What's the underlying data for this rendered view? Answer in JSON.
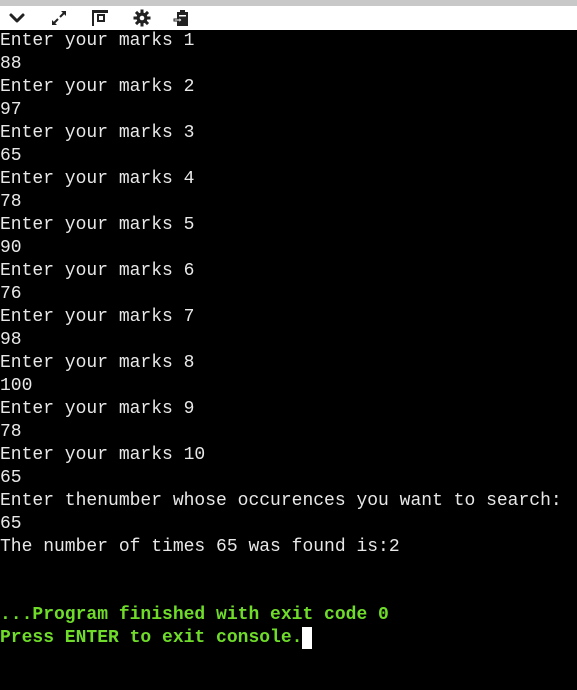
{
  "toolbar": {
    "icons": [
      "chevron-down-icon",
      "expand-icon",
      "layout-icon",
      "gear-icon",
      "clipboard-icon"
    ]
  },
  "console": {
    "lines": [
      "Enter your marks 1",
      "88",
      "Enter your marks 2",
      "97",
      "Enter your marks 3",
      "65",
      "Enter your marks 4",
      "78",
      "Enter your marks 5",
      "90",
      "Enter your marks 6",
      "76",
      "Enter your marks 7",
      "98",
      "Enter your marks 8",
      "100",
      "Enter your marks 9",
      "78",
      "Enter your marks 10",
      "65",
      "Enter thenumber whose occurences you want to search:",
      "65",
      "The number of times 65 was found is:2"
    ],
    "exit_message": "...Program finished with exit code 0",
    "press_enter": "Press ENTER to exit console."
  },
  "colors": {
    "background": "#000000",
    "text": "#e8e8e8",
    "exit_text": "#6fdc2a",
    "toolbar": "#ffffff"
  }
}
